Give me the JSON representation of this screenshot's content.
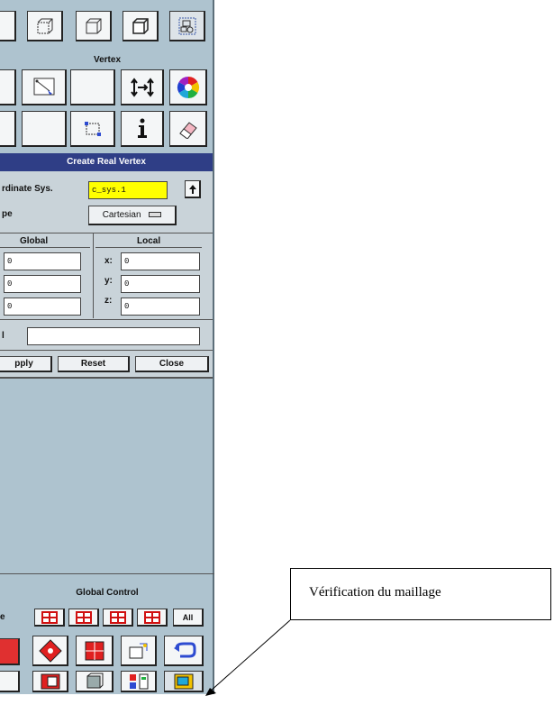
{
  "vertex": {
    "section_title": "Vertex"
  },
  "create_real_vertex": {
    "title": "Create Real Vertex",
    "coord_sys_label": "rdinate Sys.",
    "coord_sys_value": "c_sys.1",
    "type_label": "pe",
    "type_value": "Cartesian",
    "global_header": "Global",
    "local_header": "Local",
    "global_values": [
      "0",
      "0",
      "0"
    ],
    "local_labels": [
      "x:",
      "y:",
      "z:"
    ],
    "local_values": [
      "0",
      "0",
      "0"
    ],
    "label_label": "l",
    "label_value": "",
    "apply_label": "pply",
    "reset_label": "Reset",
    "close_label": "Close"
  },
  "global_control": {
    "title": "Global Control",
    "row_label": "e",
    "all_label": "All"
  },
  "callout": {
    "text": "Vérification du maillage"
  },
  "colors": {
    "panel_bg": "#aec3cf",
    "form_bg": "#c9d3d9",
    "title_bar": "#2f3e86",
    "highlight_field": "#ffff00"
  }
}
